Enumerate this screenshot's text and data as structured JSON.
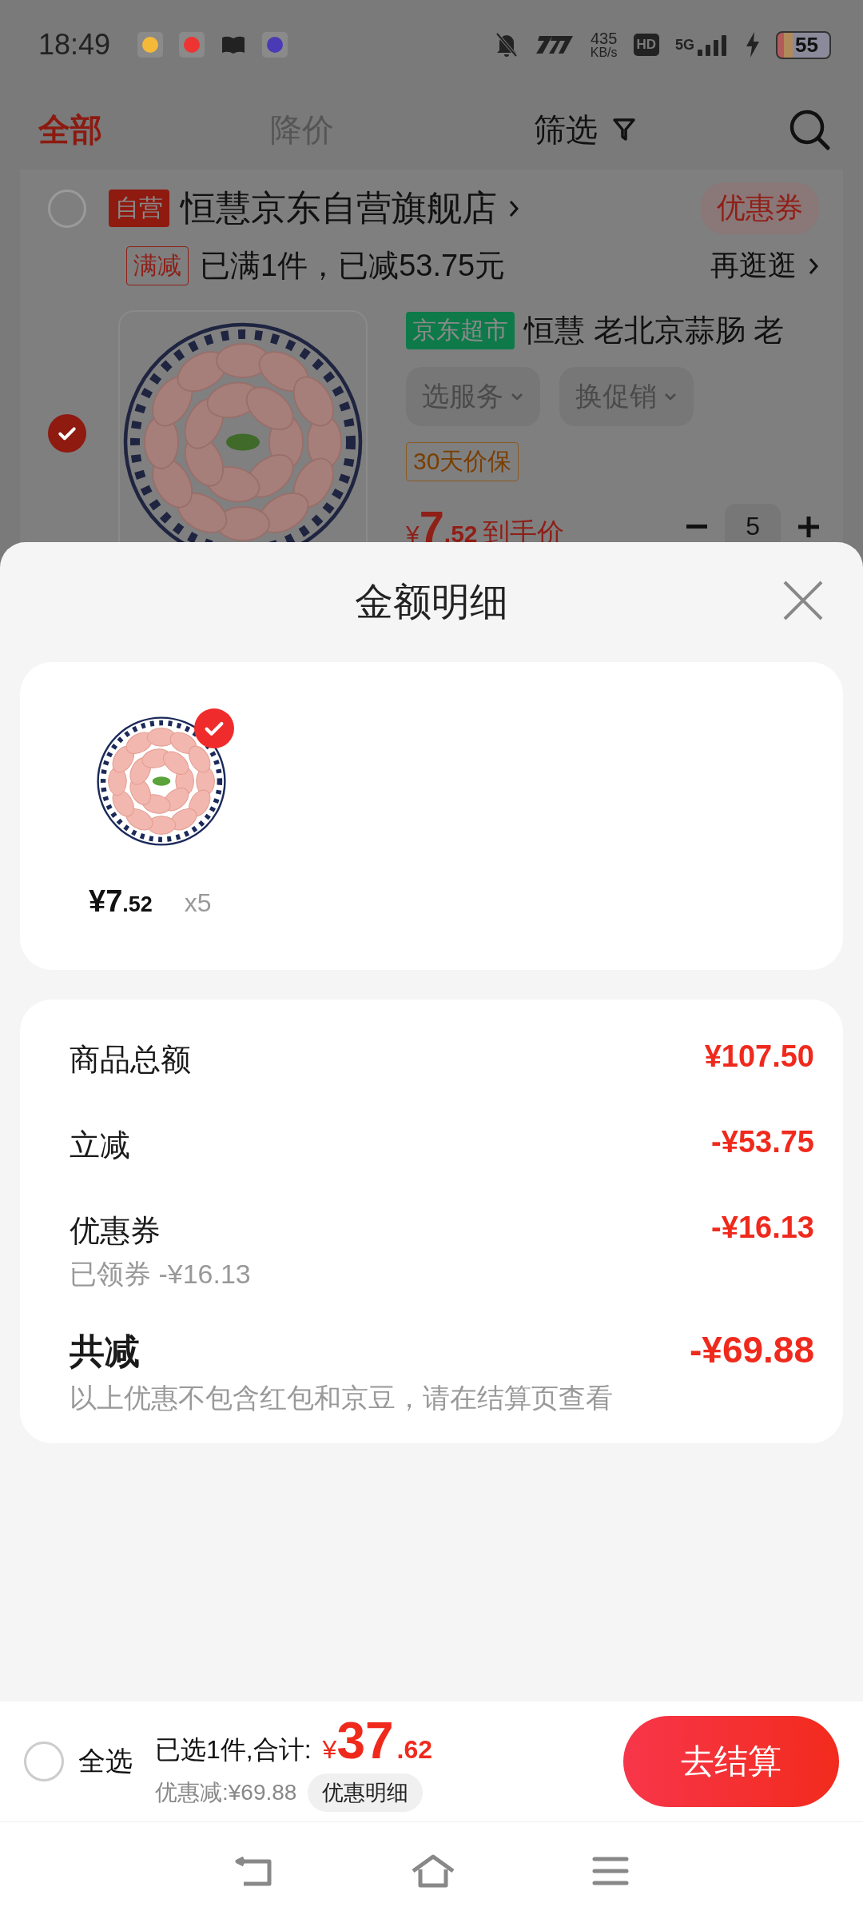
{
  "status_bar": {
    "time": "18:49",
    "speed_value": "435",
    "speed_unit": "KB/s",
    "hd": "HD",
    "network": "5G",
    "battery": "55"
  },
  "header": {
    "tabs": [
      {
        "label": "全部",
        "selected": true
      },
      {
        "label": "降价",
        "selected": false
      }
    ],
    "filter": "筛选"
  },
  "store": {
    "checked": false,
    "badge": "自营",
    "name": "恒慧京东自营旗舰店",
    "coupon": "优惠券",
    "promo_tag": "满减",
    "promo_text": "已满1件，已减53.75元",
    "more": "再逛逛"
  },
  "product": {
    "checked": true,
    "shop_tag": "京东超市",
    "title": "恒慧 老北京蒜肠 老",
    "options": [
      "选服务",
      "换促销"
    ],
    "guarantee": "30天价保",
    "price_symbol": "¥",
    "price_int": "7",
    "price_dec": ".52",
    "price_label": "到手价",
    "quantity": "5"
  },
  "sheet": {
    "title": "金额明细",
    "items": [
      {
        "checked": true,
        "price_int": "¥7",
        "price_dec": ".52",
        "quantity": "x5"
      }
    ],
    "rows": [
      {
        "kind": "line",
        "label": "商品总额",
        "value": "¥107.50"
      },
      {
        "kind": "line",
        "label": "立减",
        "value": "-¥53.75"
      },
      {
        "kind": "line",
        "label": "优惠券",
        "value": "-¥16.13",
        "note": "已领券 -¥16.13"
      },
      {
        "kind": "total",
        "label": "共减",
        "value": "-¥69.88",
        "note": "以上优惠不包含红包和京豆，请在结算页查看"
      }
    ]
  },
  "bottom_bar": {
    "select_all": {
      "label": "全选",
      "checked": false
    },
    "summary": "已选1件,合计:",
    "currency": "¥",
    "total_int": "37",
    "total_dec": ".62",
    "discount": "优惠减:¥69.88",
    "details": "优惠明细",
    "checkout": "去结算"
  }
}
